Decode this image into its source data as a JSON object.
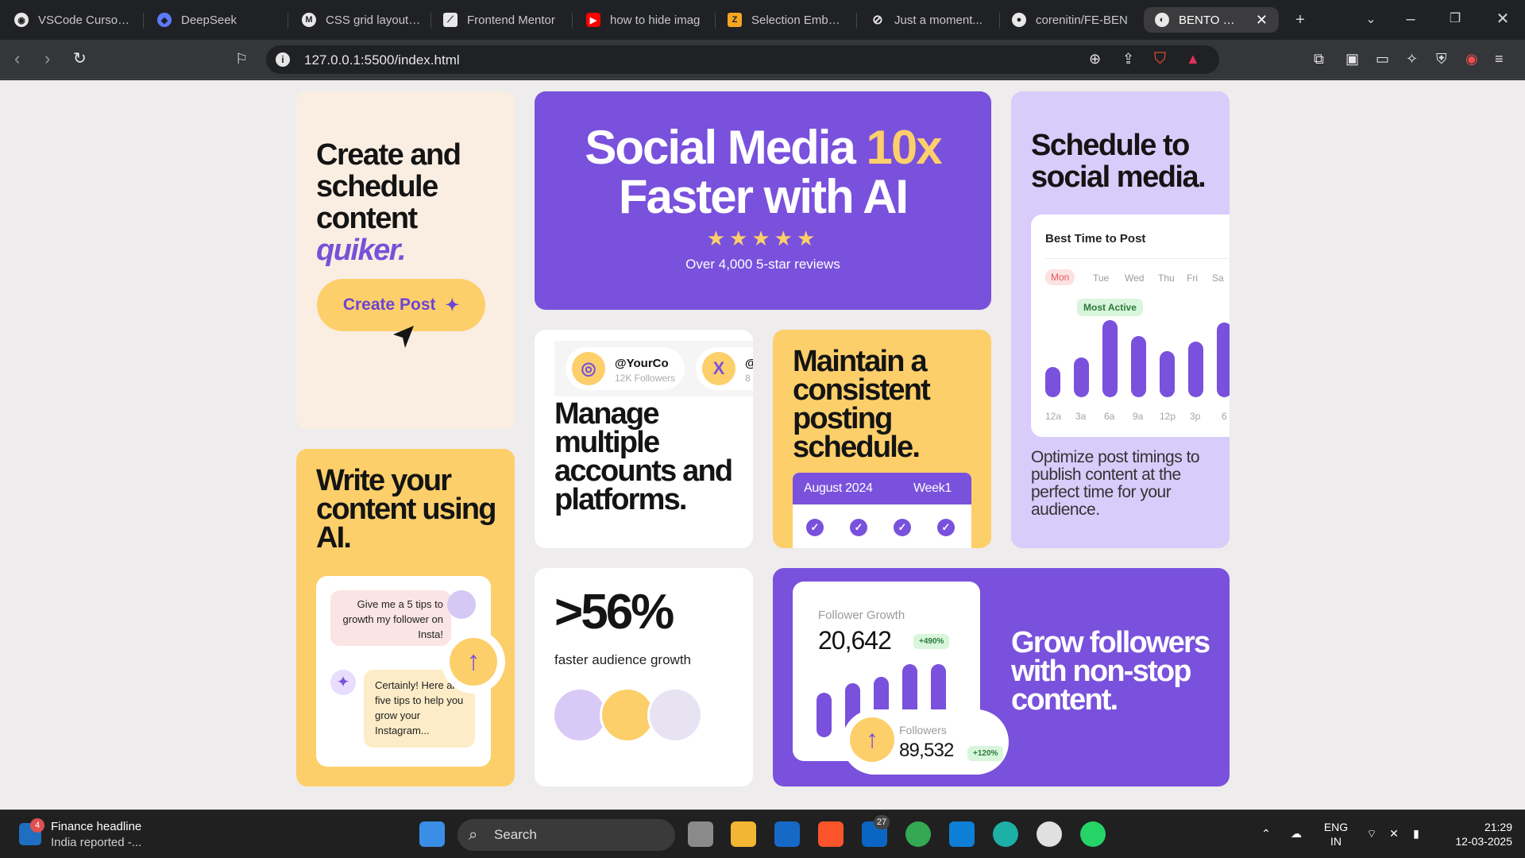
{
  "browser": {
    "tabs": [
      {
        "title": "VSCode Cursor St",
        "color": "#e8e8e8"
      },
      {
        "title": "DeepSeek",
        "color": "#5b7cfa"
      },
      {
        "title": "CSS grid layout - (",
        "color": "#e8e8e8"
      },
      {
        "title": "Frontend Mentor",
        "color": "#e8e8e8"
      },
      {
        "title": "how to hide imag",
        "color": "#ff0000"
      },
      {
        "title": "Selection Embed (",
        "color": "#f5a623"
      },
      {
        "title": "Just a moment...",
        "color": "#e8e8e8"
      },
      {
        "title": "corenitin/FE-BEN",
        "color": "#e8e8e8"
      }
    ],
    "active_tab": {
      "title": "BENTO GRID",
      "close": "✕"
    },
    "new_tab": "+",
    "url": "127.0.0.1:5500/index.html"
  },
  "cards": {
    "create": {
      "heading_lines": [
        "Create and",
        "schedule",
        "content"
      ],
      "heading_accent": "quiker.",
      "button_label": "Create Post",
      "button_icon": "✦"
    },
    "hero": {
      "title_line1_a": "Social Media ",
      "title_line1_b": "10x",
      "title_line2": "Faster with AI",
      "stars": "★★★★★",
      "reviews": "Over 4,000 5-star reviews"
    },
    "schedule": {
      "heading_lines": [
        "Schedule to",
        "social media."
      ],
      "chart_title": "Best Time to Post",
      "days": [
        "Mon",
        "Tue",
        "Wed",
        "Thu",
        "Fri",
        "Sa"
      ],
      "badge": "Most Active",
      "bar_labels": [
        "12a",
        "3a",
        "6a",
        "9a",
        "12p",
        "3p",
        "6"
      ],
      "description": "Optimize post timings to publish content at the perfect time for your audience."
    },
    "write": {
      "heading_lines": [
        "Write your",
        "content using",
        "AI."
      ],
      "user_message": "Give me a 5 tips to growth my follower on Insta!",
      "ai_message": "Certainly! Here are five tips to help you grow your Instagram...",
      "spark_icon": "✦",
      "send_icon": "↑"
    },
    "manage": {
      "accounts": [
        {
          "handle": "@YourCo",
          "followers": "12K Followers",
          "icon": "◎"
        },
        {
          "handle": "@",
          "followers": "8",
          "icon": "X"
        }
      ],
      "heading_lines": [
        "Manage",
        "multiple",
        "accounts and",
        "platforms."
      ]
    },
    "consistent": {
      "heading_lines": [
        "Maintain a",
        "consistent",
        "posting",
        "schedule."
      ],
      "month": "August 2024",
      "week": "Week1",
      "check": "✓"
    },
    "growth": {
      "stat": ">56%",
      "caption": "faster audience growth"
    },
    "followers": {
      "growth_label": "Follower Growth",
      "growth_value": "20,642",
      "growth_pill": "+490%",
      "followers_label": "Followers",
      "followers_value": "89,532",
      "followers_pill": "+120%",
      "up_icon": "↑",
      "heading_lines": [
        "Grow followers",
        "with non-stop",
        "content."
      ]
    }
  },
  "taskbar": {
    "news_badge": "4",
    "news_title": "Finance headline",
    "news_sub": "India reported -...",
    "search": "Search",
    "linkedin_badge": "27",
    "lang1": "ENG",
    "lang2": "IN",
    "time": "21:29",
    "date": "12-03-2025"
  },
  "colors": {
    "purple": "#7951dc",
    "yellow": "#fdcf6a",
    "cream": "#faeee2",
    "lavender": "#d8ccfb"
  }
}
